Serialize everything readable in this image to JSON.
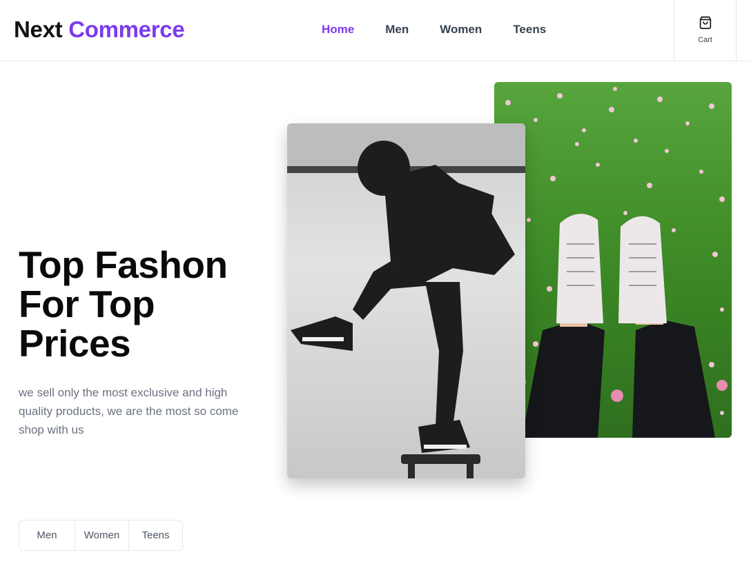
{
  "header": {
    "logo_part1": "Next",
    "logo_part2": "Commerce",
    "nav": [
      {
        "label": "Home",
        "active": true
      },
      {
        "label": "Men",
        "active": false
      },
      {
        "label": "Women",
        "active": false
      },
      {
        "label": "Teens",
        "active": false
      }
    ],
    "cart": {
      "label": "Cart",
      "icon": "shopping-bag-icon"
    }
  },
  "hero": {
    "title": "Top Fashon For Top Prices",
    "subtitle": "we sell only the most exclusive and high quality products, we are the most so come shop with us",
    "images": [
      {
        "name": "grass-sneakers-photo",
        "description": "feet in white high-top sneakers on grass with pink flowers"
      },
      {
        "name": "man-jumping-photo",
        "description": "black and white photo of a man in hoodie stepping on a stool"
      }
    ]
  },
  "categories": [
    {
      "label": "Men"
    },
    {
      "label": "Women"
    },
    {
      "label": "Teens"
    }
  ],
  "colors": {
    "accent": "#7c3aed",
    "text": "#111111",
    "muted": "#6b7280",
    "border": "#e5e7eb"
  }
}
